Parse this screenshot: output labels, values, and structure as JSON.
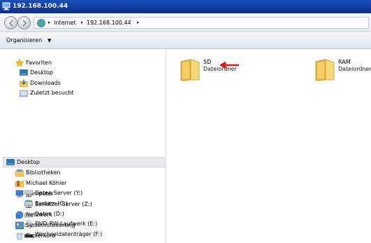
{
  "window": {
    "title": "192.168.100.44"
  },
  "address": {
    "crumbs": [
      "Internet",
      "192.168.100.44"
    ]
  },
  "toolbar": {
    "organize_label": "Organisieren"
  },
  "nav": {
    "favorites": {
      "header": "Favoriten",
      "items": [
        "Desktop",
        "Downloads",
        "Zuletzt besucht"
      ]
    },
    "desktop": {
      "header": "Desktop",
      "items": [
        "Bibliotheken",
        "Michael Köhler",
        "Computer",
        "System (C:)",
        "Daten (D:)",
        "DVD-RW-Laufwerk (E:)",
        "Wechseldatenträger (F:)",
        "Daten Server (Y:)",
        "Benutzer Server (Z:)",
        "Netzwerk",
        "Systemsteuerung",
        "Papierkorb"
      ]
    }
  },
  "content": {
    "folders": [
      {
        "name": "SD",
        "type": "Dateiordner"
      },
      {
        "name": "RAM",
        "type": "Dateiordner"
      }
    ]
  },
  "colors": {
    "titlebar": "#1a4fb8",
    "annotation_arrow": "#e8131b",
    "folder": "#f2c94c"
  }
}
